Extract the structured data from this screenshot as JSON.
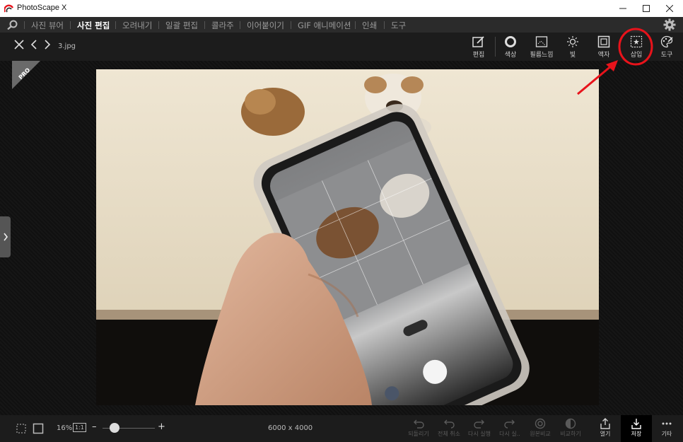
{
  "window": {
    "title": "PhotoScape X"
  },
  "menu": {
    "items": [
      {
        "label": "사진 뷰어",
        "active": false
      },
      {
        "label": "사진 편집",
        "active": true
      },
      {
        "label": "오려내기",
        "active": false
      },
      {
        "label": "일괄 편집",
        "active": false
      },
      {
        "label": "콜라주",
        "active": false
      },
      {
        "label": "이어붙이기",
        "active": false
      },
      {
        "label": "GIF 애니메이션",
        "active": false
      },
      {
        "label": "인쇄",
        "active": false
      },
      {
        "label": "도구",
        "active": false
      }
    ]
  },
  "toolbar": {
    "filename": "3.jpg",
    "tools": [
      {
        "label": "편집",
        "icon": "edit-icon"
      },
      {
        "label": "색상",
        "icon": "color-circle-icon"
      },
      {
        "label": "필름느낌",
        "icon": "film-icon"
      },
      {
        "label": "빛",
        "icon": "light-icon"
      },
      {
        "label": "액자",
        "icon": "frame-icon"
      },
      {
        "label": "삽입",
        "icon": "insert-icon"
      },
      {
        "label": "도구",
        "icon": "palette-tool-icon"
      }
    ]
  },
  "badge": {
    "text": "PRO"
  },
  "status": {
    "zoom": "16%",
    "actual_size": "1:1",
    "dimensions": "6000 x 4000",
    "zoom_level": 0.12
  },
  "bottom_actions": [
    {
      "label": "되돌리기",
      "enabled": false
    },
    {
      "label": "전체 취소",
      "enabled": false
    },
    {
      "label": "다시 실행",
      "enabled": false
    },
    {
      "label": "다시 실..",
      "enabled": false
    },
    {
      "label": "원본비교",
      "enabled": false
    },
    {
      "label": "비교하기",
      "enabled": false
    },
    {
      "label": "열기",
      "enabled": true
    },
    {
      "label": "저장",
      "enabled": true
    },
    {
      "label": "기타",
      "enabled": true
    }
  ],
  "colors": {
    "highlight_circle": "#e8131b",
    "arrow": "#e8131b",
    "active_menu": "#ffffff"
  }
}
